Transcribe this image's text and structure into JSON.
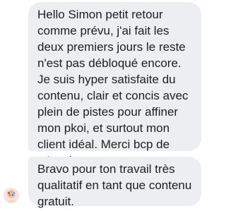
{
  "messages": [
    {
      "text": "Hello Simon petit retour comme prévu, j'ai fait les deux premiers jours le reste n'est pas débloqué encore. Je suis hyper satisfaite du contenu, clair et concis avec plein de pistes pour affiner mon pkoi, et surtout mon client idéal. Merci bcp de m'avoir envoyer ton contenu, et hâte de voir la suite",
      "emoji": "smiling-face-icon"
    },
    {
      "text": "Bravo pour ton travail très qualitatif en tant que contenu gratuit."
    }
  ],
  "colors": {
    "bubble_bg": "#eceef1",
    "text": "#1c1e21",
    "emoji_yellow": "#f8c338"
  }
}
